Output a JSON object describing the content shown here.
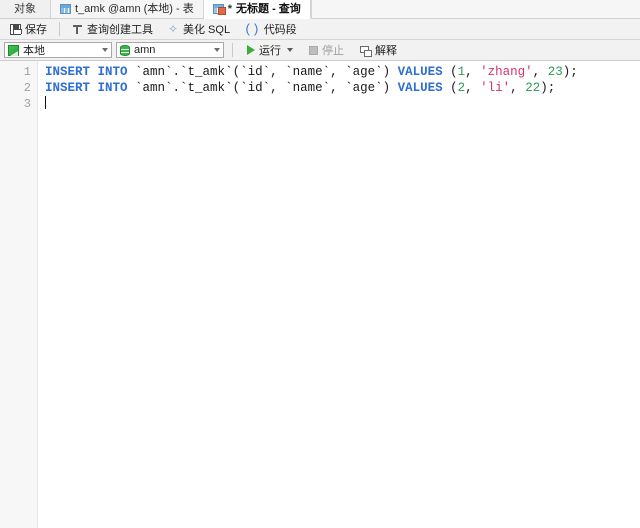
{
  "tabbar": {
    "object_tab": {
      "label": "对象",
      "icon": "none"
    },
    "table_tab": {
      "label": "t_amk @amn (本地) - 表",
      "icon": "table-grid-icon"
    },
    "query_tab": {
      "label": "无标题 - 查询",
      "dirty_marker": "*",
      "icon": "query-icon"
    }
  },
  "toolbar": {
    "save": {
      "label": "保存",
      "icon": "save-icon"
    },
    "query_builder": {
      "label": "查询创建工具",
      "icon": "query-builder-icon"
    },
    "beautify_sql": {
      "label": "美化 SQL",
      "icon": "beautify-icon",
      "glyph": "✧"
    },
    "code_snippet": {
      "label": "代码段",
      "icon": "snippet-icon",
      "glyph": "()"
    }
  },
  "toolbar2": {
    "connection": {
      "value": "本地",
      "icon": "connection-icon"
    },
    "database": {
      "value": "amn",
      "icon": "database-icon"
    },
    "run": {
      "label": "运行",
      "icon": "run-icon"
    },
    "stop": {
      "label": "停止",
      "icon": "stop-icon"
    },
    "explain": {
      "label": "解释",
      "icon": "explain-icon"
    }
  },
  "editor": {
    "line_numbers": [
      "1",
      "2",
      "3"
    ],
    "lines": [
      {
        "tokens": [
          {
            "t": "INSERT",
            "c": "kw"
          },
          {
            "t": " ",
            "c": "punc"
          },
          {
            "t": "INTO",
            "c": "kw"
          },
          {
            "t": " `amn`.`t_amk`(`id`, `name`, `age`) ",
            "c": "ident"
          },
          {
            "t": "VALUES",
            "c": "kw"
          },
          {
            "t": " (",
            "c": "punc"
          },
          {
            "t": "1",
            "c": "num"
          },
          {
            "t": ", ",
            "c": "punc"
          },
          {
            "t": "'zhang'",
            "c": "str"
          },
          {
            "t": ", ",
            "c": "punc"
          },
          {
            "t": "23",
            "c": "num"
          },
          {
            "t": ");",
            "c": "punc"
          }
        ]
      },
      {
        "tokens": [
          {
            "t": "INSERT",
            "c": "kw"
          },
          {
            "t": " ",
            "c": "punc"
          },
          {
            "t": "INTO",
            "c": "kw"
          },
          {
            "t": " `amn`.`t_amk`(`id`, `name`, `age`) ",
            "c": "ident"
          },
          {
            "t": "VALUES",
            "c": "kw"
          },
          {
            "t": " (",
            "c": "punc"
          },
          {
            "t": "2",
            "c": "num"
          },
          {
            "t": ", ",
            "c": "punc"
          },
          {
            "t": "'li'",
            "c": "str"
          },
          {
            "t": ", ",
            "c": "punc"
          },
          {
            "t": "22",
            "c": "num"
          },
          {
            "t": ");",
            "c": "punc"
          }
        ]
      },
      {
        "tokens": []
      }
    ]
  },
  "colors": {
    "keyword": "#2f6fd0",
    "number": "#2e9b57",
    "string": "#d6336c",
    "accent_green": "#35b54a",
    "gutter_bg": "#f7f7f8",
    "toolbar_bg": "#f2f2f2"
  }
}
